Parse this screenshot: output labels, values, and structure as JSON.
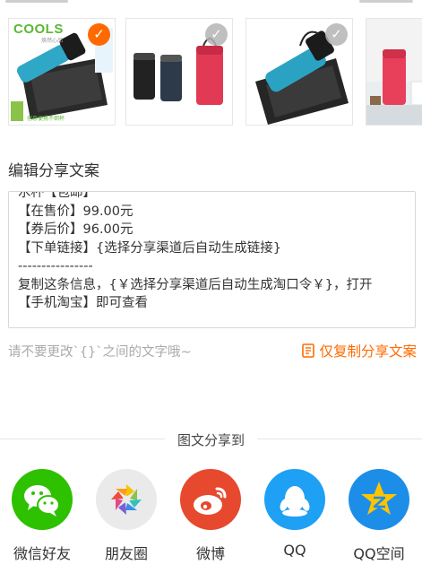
{
  "thumbnails": [
    {
      "brand": "COOLS",
      "brand_sub": "焕然心品",
      "slogan": "创意便携不倒杯",
      "selected": true
    },
    {
      "selected": false
    },
    {
      "selected": false
    },
    {
      "selected": false
    }
  ],
  "section_title": "编辑分享文案",
  "editor": {
    "lines": [
      "水杯【包邮】",
      "【在售价】99.00元",
      "【券后价】96.00元",
      "【下单链接】{选择分享渠道后自动生成链接}",
      "----------------",
      "复制这条信息，{￥选择分享渠道后自动生成淘口令￥}，打开",
      "【手机淘宝】即可查看"
    ]
  },
  "hint": "请不要更改`{}`之间的文字哦~",
  "copy_button": {
    "label": "仅复制分享文案",
    "icon": "copy-icon"
  },
  "share": {
    "title": "图文分享到",
    "items": [
      {
        "label": "微信好友",
        "icon": "wechat-icon",
        "color": "#2ec100"
      },
      {
        "label": "朋友圈",
        "icon": "moments-icon",
        "color": "#eaeaea"
      },
      {
        "label": "微博",
        "icon": "weibo-icon",
        "color": "#e6492e"
      },
      {
        "label": "QQ",
        "icon": "qq-icon",
        "color": "#1ea0f5"
      },
      {
        "label": "QQ空间",
        "icon": "qzone-icon",
        "color": "#1d8ee8"
      }
    ]
  },
  "colors": {
    "accent": "#ff6a00",
    "border": "#d8d8d8"
  }
}
